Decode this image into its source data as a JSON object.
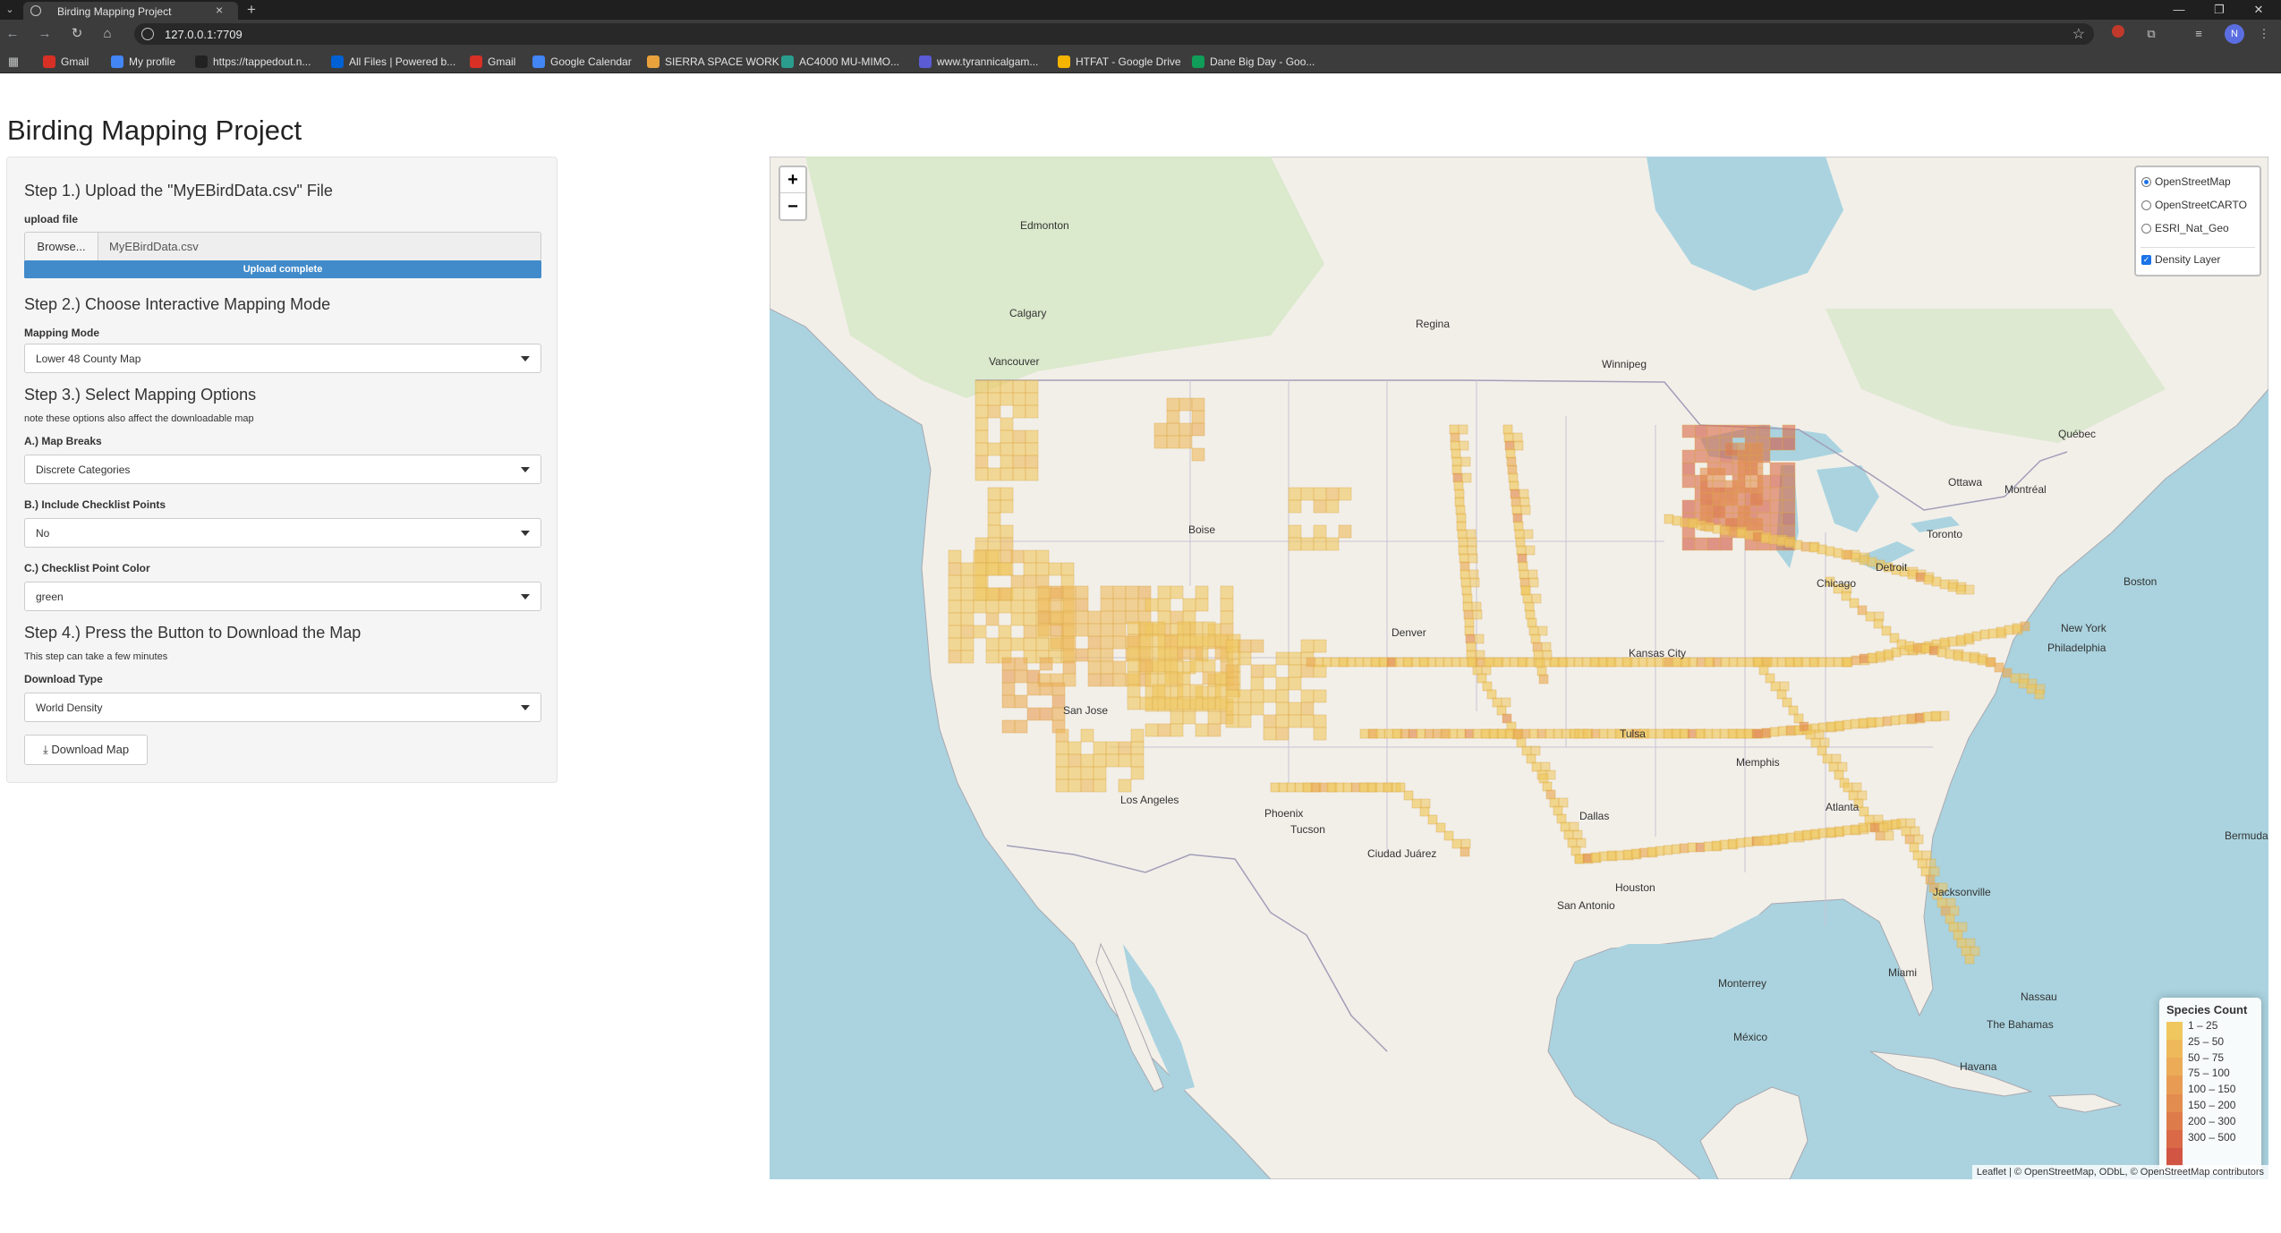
{
  "browser": {
    "tab_title": "Birding Mapping Project",
    "url": "127.0.0.1:7709",
    "profile_initial": "N",
    "bookmarks": [
      {
        "label": "Gmail",
        "icon": "gmail-icon",
        "color": "#d93025"
      },
      {
        "label": "My profile",
        "icon": "profile-icon",
        "color": "#4285f4"
      },
      {
        "label": "https://tappedout.n...",
        "icon": "tappedout-icon",
        "color": "#222222"
      },
      {
        "label": "All Files | Powered b...",
        "icon": "box-icon",
        "color": "#0061d5"
      },
      {
        "label": "Gmail",
        "icon": "gmail-icon",
        "color": "#d93025"
      },
      {
        "label": "Google Calendar",
        "icon": "calendar-icon",
        "color": "#4285f4"
      },
      {
        "label": "SIERRA SPACE WORK",
        "icon": "sierra-icon",
        "color": "#e8a33d"
      },
      {
        "label": "AC4000 MU-MIMO...",
        "icon": "router-icon",
        "color": "#2a9d8f"
      },
      {
        "label": "www.tyrannicalgam...",
        "icon": "tyrannical-icon",
        "color": "#5b5bd6"
      },
      {
        "label": "HTFAT - Google Drive",
        "icon": "drive-icon",
        "color": "#f4b400"
      },
      {
        "label": "Dane Big Day - Goo...",
        "icon": "sheets-icon",
        "color": "#0f9d58"
      }
    ]
  },
  "page": {
    "title": "Birding Mapping Project"
  },
  "sidebar": {
    "step1_heading": "Step 1.) Upload the \"MyEBirdData.csv\" File",
    "upload_label": "upload file",
    "browse_label": "Browse...",
    "file_name": "MyEBirdData.csv",
    "upload_status": "Upload complete",
    "upload_progress": 1.0,
    "step2_heading": "Step 2.) Choose Interactive Mapping Mode",
    "mapping_mode_label": "Mapping Mode",
    "mapping_mode_value": "Lower 48 County Map",
    "step3_heading": "Step 3.) Select Mapping Options",
    "step3_note": "note these options also affect the downloadable map",
    "map_breaks_label": "A.) Map Breaks",
    "map_breaks_value": "Discrete Categories",
    "checklist_points_label": "B.) Include Checklist Points",
    "checklist_points_value": "No",
    "point_color_label": "C.) Checklist Point Color",
    "point_color_value": "green",
    "step4_heading": "Step 4.) Press the Button to Download the Map",
    "step4_note": "This step can take a few minutes",
    "download_type_label": "Download Type",
    "download_type_value": "World Density",
    "download_button": "Download Map"
  },
  "map": {
    "zoom_in": "+",
    "zoom_out": "−",
    "base_layers": [
      {
        "label": "OpenStreetMap",
        "selected": true
      },
      {
        "label": "OpenStreetCARTO",
        "selected": false
      },
      {
        "label": "ESRI_Nat_Geo",
        "selected": false
      }
    ],
    "overlay": {
      "label": "Density Layer",
      "checked": true
    },
    "legend": {
      "title": "Species Count",
      "items": [
        "1 – 25",
        "25 – 50",
        "50 – 75",
        "75 – 100",
        "100 – 150",
        "150 – 200",
        "200 – 300",
        "300 – 500"
      ],
      "colors": [
        "#f0c75e",
        "#eeb95b",
        "#ebab57",
        "#e89c53",
        "#e38c4f",
        "#de7b4b",
        "#d96947",
        "#d25543"
      ]
    },
    "attribution": "Leaflet | © OpenStreetMap, ODbL, © OpenStreetMap contributors",
    "cities": [
      {
        "name": "Edmonton"
      },
      {
        "name": "Calgary"
      },
      {
        "name": "Regina"
      },
      {
        "name": "Winnipeg"
      },
      {
        "name": "Vancouver"
      },
      {
        "name": "Boise"
      },
      {
        "name": "Denver"
      },
      {
        "name": "Kansas City"
      },
      {
        "name": "Tulsa"
      },
      {
        "name": "Dallas"
      },
      {
        "name": "Houston"
      },
      {
        "name": "San Antonio"
      },
      {
        "name": "Phoenix"
      },
      {
        "name": "Tucson"
      },
      {
        "name": "Los Angeles"
      },
      {
        "name": "San Jose"
      },
      {
        "name": "Chicago"
      },
      {
        "name": "Detroit"
      },
      {
        "name": "Toronto"
      },
      {
        "name": "Ottawa"
      },
      {
        "name": "Montréal"
      },
      {
        "name": "Québec"
      },
      {
        "name": "Boston"
      },
      {
        "name": "New York"
      },
      {
        "name": "Philadelphia"
      },
      {
        "name": "Atlanta"
      },
      {
        "name": "Memphis"
      },
      {
        "name": "Jacksonville"
      },
      {
        "name": "Miami"
      },
      {
        "name": "Monterrey"
      },
      {
        "name": "México"
      },
      {
        "name": "Ciudad Juárez"
      },
      {
        "name": "Havana"
      },
      {
        "name": "Nassau"
      },
      {
        "name": "The Bahamas"
      },
      {
        "name": "Bermuda"
      }
    ]
  }
}
